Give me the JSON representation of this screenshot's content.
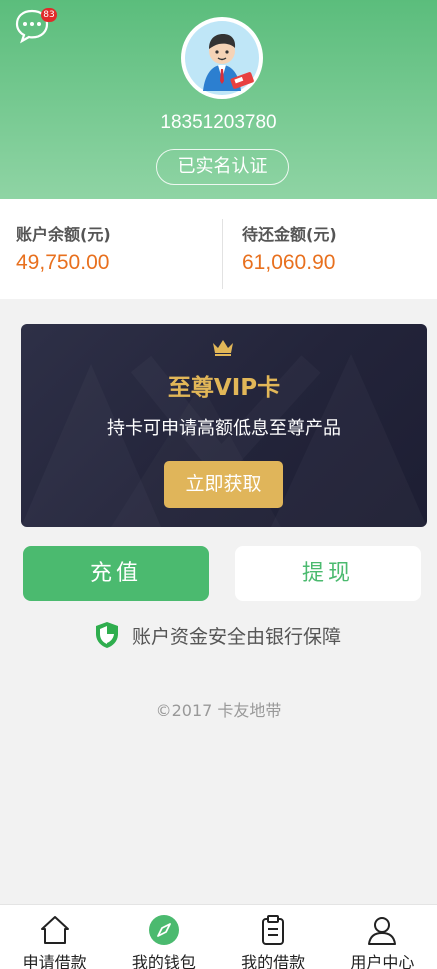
{
  "header": {
    "message_badge": "83",
    "phone": "18351203780",
    "verified_label": "已实名认证"
  },
  "balances": {
    "account": {
      "label": "账户余额(元)",
      "value": "49,750.00"
    },
    "due": {
      "label": "待还金额(元)",
      "value": "61,060.90"
    }
  },
  "vip": {
    "title": "至尊VIP卡",
    "subtitle": "持卡可申请高额低息至尊产品",
    "button": "立即获取"
  },
  "actions": {
    "recharge": "充值",
    "withdraw": "提现"
  },
  "security_note": "账户资金安全由银行保障",
  "copyright": "©2017 卡友地带",
  "tabbar": [
    {
      "label": "申请借款",
      "icon": "home-icon"
    },
    {
      "label": "我的钱包",
      "icon": "compass-icon"
    },
    {
      "label": "我的借款",
      "icon": "clipboard-icon"
    },
    {
      "label": "用户中心",
      "icon": "user-icon"
    }
  ],
  "colors": {
    "brand_green": "#4bba6f",
    "amount_orange": "#e8701e",
    "vip_gold": "#e0b55a"
  }
}
